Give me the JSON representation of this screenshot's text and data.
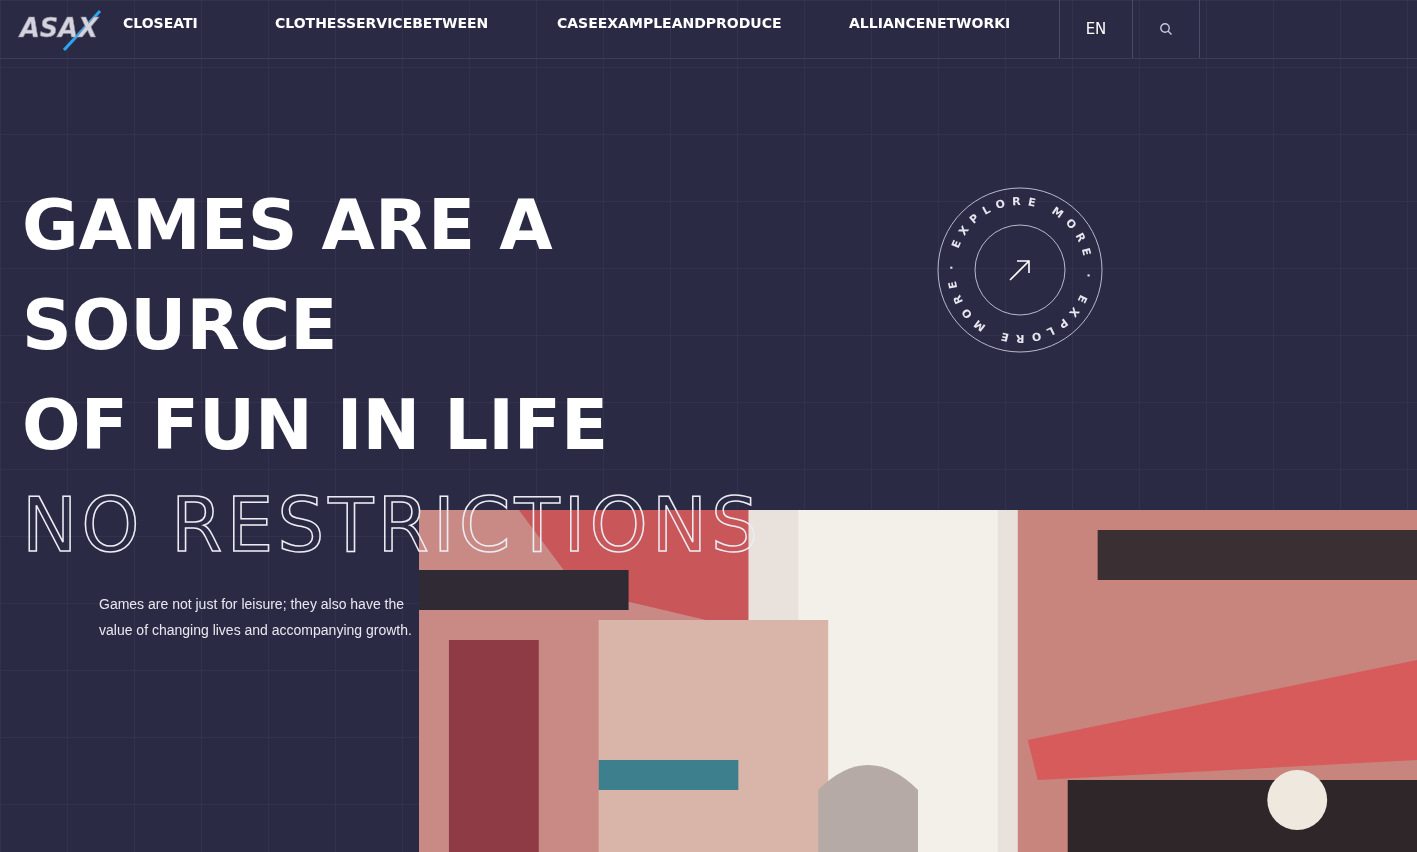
{
  "logo": {
    "text": "ASAX"
  },
  "nav": {
    "items": [
      {
        "label": "CLOSEATI"
      },
      {
        "label": "CLOTHESSERVICEBETWEEN"
      },
      {
        "label": "CASEEXAMPLEANDPRODUCE"
      },
      {
        "label": "ALLIANCENETWORKI"
      }
    ],
    "language": "EN"
  },
  "hero": {
    "headline_lines": [
      "GAMES ARE A",
      "SOURCE",
      "OF FUN IN LIFE"
    ],
    "outline_line": "NO RESTRICTIONS",
    "description": "Games are not just for leisure; they also have the value of changing lives and accompanying growth.",
    "explore_badge": {
      "text": "· EXPLORE MORE · EXPLORE MORE"
    },
    "image": {
      "kind": "picture"
    }
  }
}
